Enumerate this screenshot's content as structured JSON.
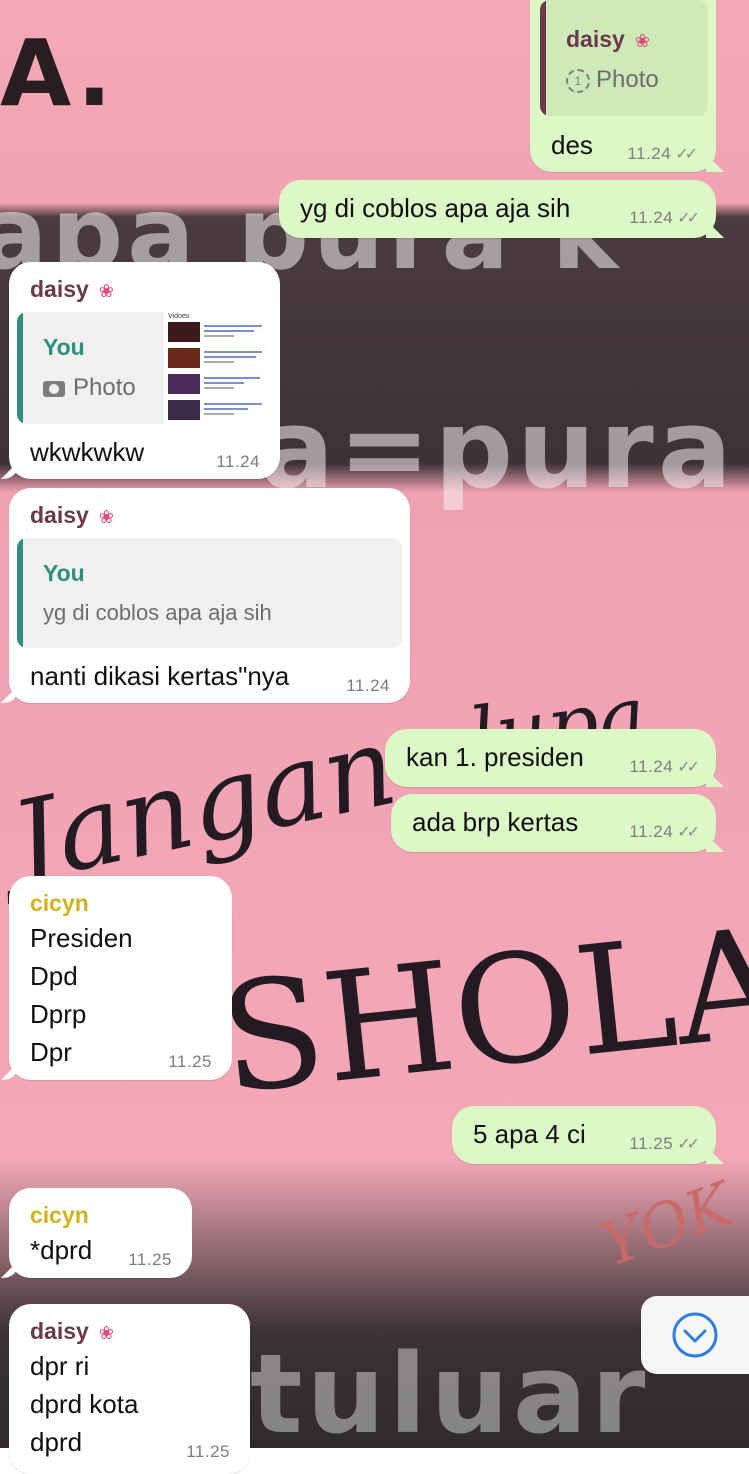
{
  "messages": [
    {
      "sender": "daisy",
      "reply_to": {
        "author": "daisy",
        "label": "Photo"
      },
      "text": "des",
      "time": "11.24"
    },
    {
      "text": "yg di coblos apa aja sih",
      "time": "11.24"
    },
    {
      "sender": "daisy",
      "reply_to": {
        "author": "You",
        "label": "Photo"
      },
      "text": "wkwkwkw",
      "time": "11.24"
    },
    {
      "sender": "daisy",
      "reply_to": {
        "author": "You",
        "text": "yg di coblos apa aja sih"
      },
      "text": "nanti dikasi kertas\"nya",
      "time": "11.24"
    },
    {
      "text": "kan 1. presiden",
      "time": "11.24"
    },
    {
      "text": "ada brp kertas",
      "time": "11.24"
    },
    {
      "sender": "cicyn",
      "lines": [
        "Presiden",
        "Dpd",
        "Dprp",
        "Dpr"
      ],
      "time": "11.25"
    },
    {
      "text": "5 apa 4 ci",
      "time": "11.25"
    },
    {
      "sender": "cicyn",
      "text": "*dprd",
      "time": "11.25"
    },
    {
      "sender": "daisy",
      "lines": [
        "dpr ri",
        "dprd kota",
        "dprd"
      ],
      "time": "11.25"
    }
  ],
  "thumbnail_header": "Vidoes",
  "wallpaper_text": [
    "A.",
    "apa pura k",
    "a=pura",
    "Jangan",
    "lupa",
    "SHOLAT",
    "YOK",
    "tuluar"
  ],
  "colors": {
    "outgoing": "#dcf8c6",
    "incoming": "#ffffff",
    "daisy": "#6b3a4a",
    "cicyn": "#d0b21a",
    "you": "#2f8f7e"
  },
  "icons": [
    "lotus-emoji-icon",
    "view-once-icon",
    "camera-icon",
    "double-check-icon",
    "chevron-down-circle-icon"
  ]
}
